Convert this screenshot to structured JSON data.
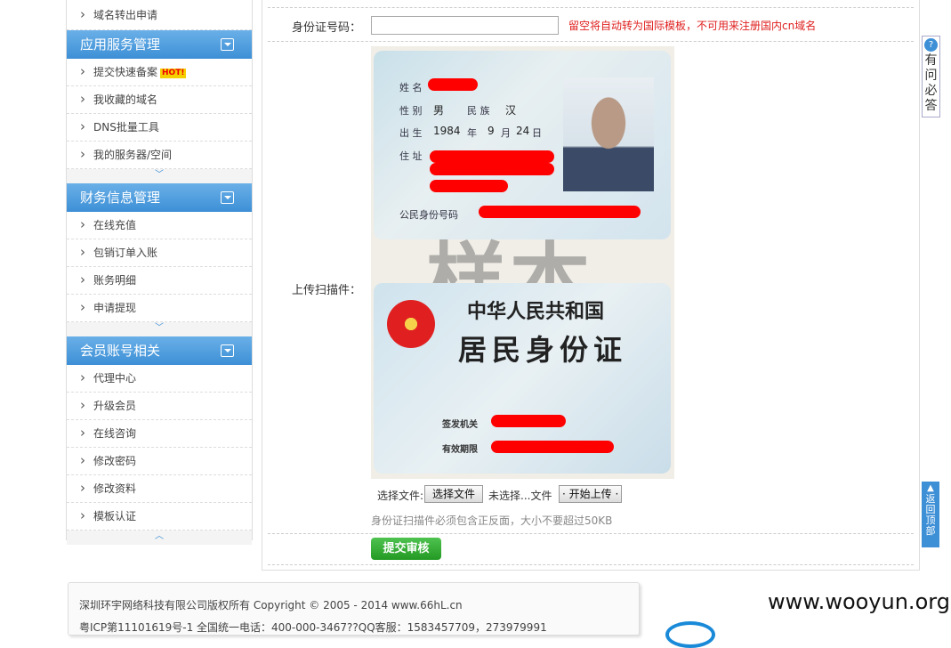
{
  "sidebar": {
    "top_item": "域名转出申请",
    "sections": [
      {
        "title": "应用服务管理",
        "items": [
          "提交快速备案",
          "我收藏的域名",
          "DNS批量工具",
          "我的服务器/空间"
        ],
        "hot_badge": "HOT!"
      },
      {
        "title": "财务信息管理",
        "items": [
          "在线充值",
          "包销订单入账",
          "账务明细",
          "申请提现"
        ]
      },
      {
        "title": "会员账号相关",
        "items": [
          "代理中心",
          "升级会员",
          "在线咨询",
          "修改密码",
          "修改资料",
          "模板认证"
        ]
      }
    ]
  },
  "form": {
    "id_label": "身份证号码：",
    "id_value": "",
    "id_warning": "留空将自动转为国际模板，不可用来注册国内cn域名",
    "upload_label": "上传扫描件：",
    "file_label": "选择文件:",
    "choose_file_btn": "选择文件",
    "no_file_text": "未选择...文件",
    "start_upload_btn": "· 开始上传 ·",
    "hint": "身份证扫描件必须包含正反面，大小不要超过50KB",
    "submit": "提交审核"
  },
  "idcard": {
    "front_labels": {
      "name": "姓 名",
      "sex": "性 别",
      "nation": "民 族",
      "birth": "出 生",
      "addr": "住 址",
      "idno": "公民身份号码"
    },
    "front_values": {
      "sex": "男",
      "nation": "汉",
      "birth_year": "1984",
      "year": "年",
      "birth_month": "9",
      "month": "月",
      "birth_day": "24",
      "day": "日"
    },
    "watermark": "样本",
    "back_title1": "中华人民共和国",
    "back_title2": "居民身份证",
    "back_issuer": "签发机关",
    "back_valid": "有效期限"
  },
  "floating": {
    "faq": "有问必答",
    "back_top": "返回顶部"
  },
  "footer": {
    "line1": "深圳环宇网络科技有限公司版权所有 Copyright © 2005 - 2014 www.66hL.cn",
    "line2": "粤ICP第11101619号-1 全国统一电话：400-000-3467??QQ客服：1583457709，273979991"
  },
  "watermark_site": "www.wooyun.org"
}
